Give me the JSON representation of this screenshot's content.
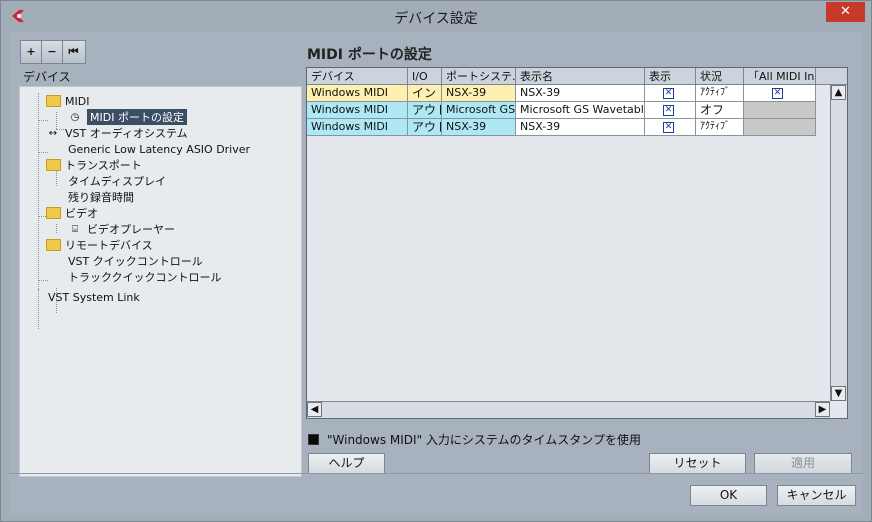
{
  "window": {
    "title": "デバイス設定"
  },
  "toolbar": {
    "add": "+",
    "remove": "−",
    "reset": "⏮"
  },
  "left": {
    "section_label": "デバイス",
    "tree": [
      {
        "label": "MIDI"
      },
      {
        "label": "MIDI ポートの設定"
      },
      {
        "label": "VST オーディオシステム"
      },
      {
        "label": "Generic Low Latency ASIO Driver"
      },
      {
        "label": "トランスポート"
      },
      {
        "label": "タイムディスプレイ"
      },
      {
        "label": "残り録音時間"
      },
      {
        "label": "ビデオ"
      },
      {
        "label": "ビデオプレーヤー"
      },
      {
        "label": "リモートデバイス"
      },
      {
        "label": "VST クイックコントロール"
      },
      {
        "label": "トラッククイックコントロール"
      },
      {
        "label": "VST System Link"
      }
    ]
  },
  "right": {
    "title": "MIDI ポートの設定",
    "columns": [
      "デバイス",
      "I/O",
      "ポートシステ.",
      "表示名",
      "表示",
      "状況",
      "「All MIDI In"
    ],
    "rows": [
      {
        "device": "Windows MIDI",
        "io": "イン",
        "port": "NSX-39",
        "name": "NSX-39",
        "visible": "✕",
        "status": "ｱｸﾃｨﾌﾞ",
        "allin": "✕"
      },
      {
        "device": "Windows MIDI",
        "io": "アウト",
        "port": "Microsoft GS",
        "name": "Microsoft GS Wavetable",
        "visible": "✕",
        "status": "オフ",
        "allin": ""
      },
      {
        "device": "Windows MIDI",
        "io": "アウト",
        "port": "NSX-39",
        "name": "NSX-39",
        "visible": "✕",
        "status": "ｱｸﾃｨﾌﾞ",
        "allin": ""
      }
    ],
    "timestamp_option": "\"Windows MIDI\" 入力にシステムのタイムスタンプを使用",
    "help": "ヘルプ",
    "reset": "リセット",
    "apply": "適用"
  },
  "footer": {
    "ok": "OK",
    "cancel": "キャンセル"
  },
  "colors": {
    "in_row": "#fdf0b0",
    "out_row": "#aee8f4",
    "selected": "#3c4e66"
  }
}
